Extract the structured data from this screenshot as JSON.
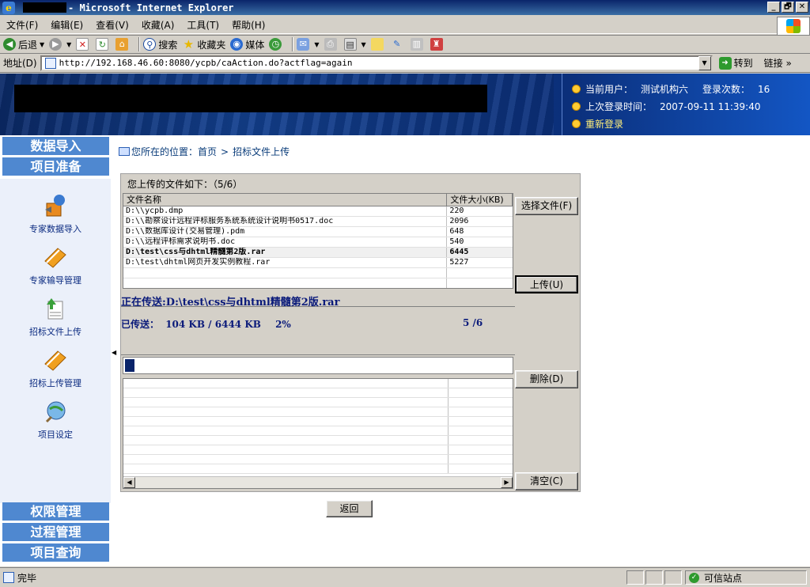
{
  "window": {
    "title": "- Microsoft Internet Explorer",
    "min_glyph": "_",
    "max_glyph": "🗗",
    "close_glyph": "✕"
  },
  "menu": [
    "文件(F)",
    "编辑(E)",
    "查看(V)",
    "收藏(A)",
    "工具(T)",
    "帮助(H)"
  ],
  "toolbar": {
    "back": "后退",
    "search": "搜索",
    "favorites": "收藏夹",
    "media": "媒体"
  },
  "address": {
    "label": "地址(D)",
    "url": "http://192.168.46.60:8080/ycpb/caAction.do?actflag=again",
    "go": "转到",
    "links": "链接"
  },
  "header": {
    "current_user_label": "当前用户：",
    "current_user": "测试机构六",
    "login_count_label": "登录次数：",
    "login_count": "16",
    "last_login_label": "上次登录时间：",
    "last_login": "2007-09-11 11:39:40",
    "relogin": "重新登录"
  },
  "sidebar": {
    "top_sections": [
      "数据导入",
      "项目准备"
    ],
    "items": [
      {
        "label": "专家数据导入",
        "icon": "import-tool-icon"
      },
      {
        "label": "专家输导管理",
        "icon": "book-icon"
      },
      {
        "label": "招标文件上传",
        "icon": "upload-document-icon"
      },
      {
        "label": "招标上传管理",
        "icon": "book-icon"
      },
      {
        "label": "项目设定",
        "icon": "magnifier-globe-icon"
      }
    ],
    "bottom_sections": [
      "权限管理",
      "过程管理",
      "项目查询"
    ]
  },
  "breadcrumb": {
    "prefix": "您所在的位置：",
    "home": "首页",
    "sep": ">",
    "current": "招标文件上传"
  },
  "upload": {
    "title": "您上传的文件如下：（5/6）",
    "columns": [
      "文件名称",
      "文件大小(KB)"
    ],
    "files": [
      {
        "name": "D:\\\\ycpb.dmp",
        "size": "220",
        "active": false
      },
      {
        "name": "D:\\\\勘察设计远程评标服务系统系统设计说明书0517.doc",
        "size": "2096",
        "active": false
      },
      {
        "name": "D:\\\\数据库设计(交易管理).pdm",
        "size": "648",
        "active": false
      },
      {
        "name": "D:\\\\远程评标需求说明书.doc",
        "size": "540",
        "active": false
      },
      {
        "name": "D:\\test\\css与dhtml精髓第2版.rar",
        "size": "6445",
        "active": true
      },
      {
        "name": "D:\\test\\dhtml网页开发实例教程.rar",
        "size": "5227",
        "active": false
      }
    ],
    "transferring_label": "正在传送:D:\\test\\css与dhtml精髓第2版.rar",
    "transferred_label": "已传送：",
    "transferred_value": "104 KB / 6444 KB",
    "percent_text": "2%",
    "progress_fraction": 0.02,
    "count_text": "5 /6",
    "buttons": {
      "select": "选择文件(F)",
      "upload": "上传(U)",
      "delete": "删除(D)",
      "clear": "清空(C)"
    },
    "back_button": "返回"
  },
  "status": {
    "text": "完毕",
    "zone": "可信站点"
  }
}
